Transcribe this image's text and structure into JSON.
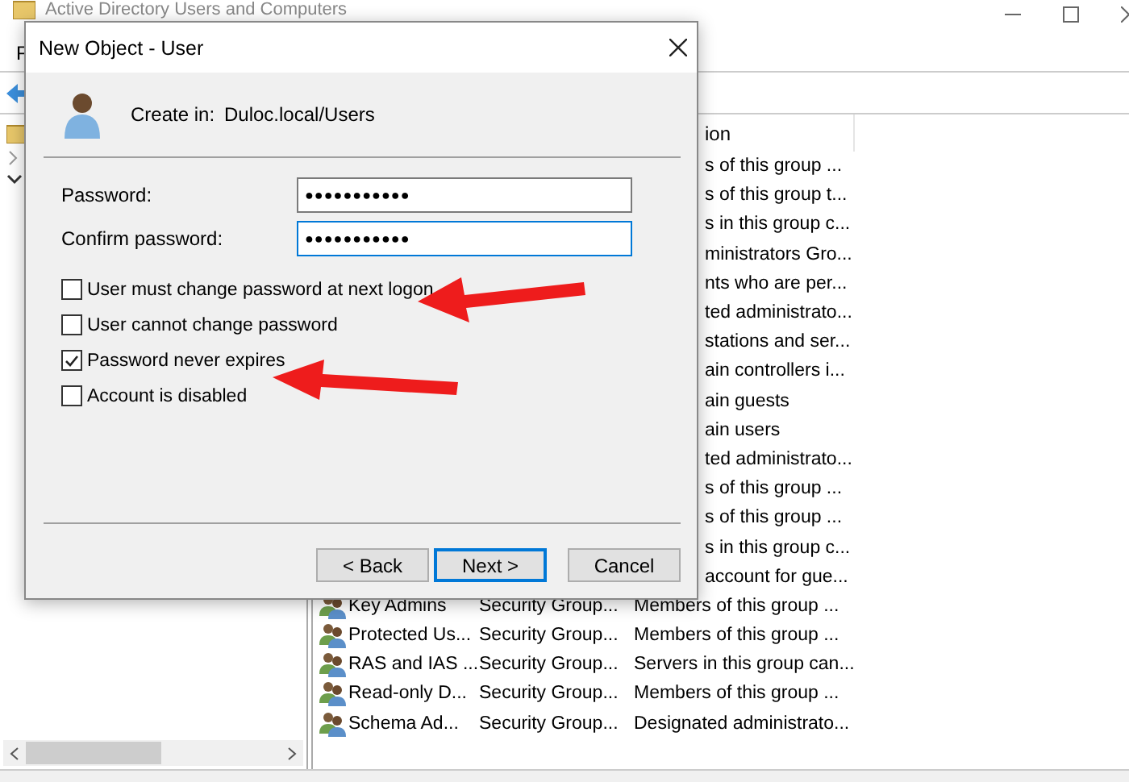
{
  "main_window": {
    "title": "Active Directory Users and Computers",
    "menu": [
      "F"
    ]
  },
  "list": {
    "columns": [
      {
        "label": "ion"
      }
    ],
    "rows": [
      {
        "kind": "covered",
        "description": "s of this group ..."
      },
      {
        "kind": "covered",
        "description": "s of this group t..."
      },
      {
        "kind": "covered",
        "description": "s in this group c..."
      },
      {
        "kind": "covered",
        "description": "ministrators Gro..."
      },
      {
        "kind": "covered",
        "description": "nts who are per..."
      },
      {
        "kind": "covered",
        "description": "ted administrato..."
      },
      {
        "kind": "covered",
        "description": "stations and ser..."
      },
      {
        "kind": "covered",
        "description": "ain controllers i..."
      },
      {
        "kind": "covered",
        "description": "ain guests"
      },
      {
        "kind": "covered",
        "description": "ain users"
      },
      {
        "kind": "covered",
        "description": "ted administrato..."
      },
      {
        "kind": "covered",
        "description": "s of this group ..."
      },
      {
        "kind": "covered",
        "description": "s of this group ..."
      },
      {
        "kind": "covered",
        "description": "s in this group c..."
      },
      {
        "kind": "covered",
        "description": "account for gue..."
      },
      {
        "kind": "group",
        "name": "Key Admins",
        "type": "Security Group...",
        "description": "Members of this group ..."
      },
      {
        "kind": "group",
        "name": "Protected Us...",
        "type": "Security Group...",
        "description": "Members of this group ..."
      },
      {
        "kind": "group",
        "name": "RAS and IAS ...",
        "type": "Security Group...",
        "description": "Servers in this group can..."
      },
      {
        "kind": "group",
        "name": "Read-only D...",
        "type": "Security Group...",
        "description": "Members of this group ..."
      },
      {
        "kind": "group",
        "name": "Schema Ad...",
        "type": "Security Group...",
        "description": "Designated administrato..."
      }
    ]
  },
  "dialog": {
    "title": "New Object - User",
    "create_in_label": "Create in:",
    "create_in_value": "Duloc.local/Users",
    "fields": [
      {
        "label": "Password:",
        "value": "●●●●●●●●●●●",
        "focused": false
      },
      {
        "label": "Confirm password:",
        "value": "●●●●●●●●●●●",
        "focused": true
      }
    ],
    "options": [
      {
        "label": "User must change password at next logon",
        "checked": false
      },
      {
        "label": "User cannot change password",
        "checked": false
      },
      {
        "label": "Password never expires",
        "checked": true
      },
      {
        "label": "Account is disabled",
        "checked": false
      }
    ],
    "buttons": [
      {
        "label": "< Back",
        "default": false
      },
      {
        "label": "Next >",
        "default": true
      },
      {
        "label": "Cancel",
        "default": false
      }
    ]
  }
}
